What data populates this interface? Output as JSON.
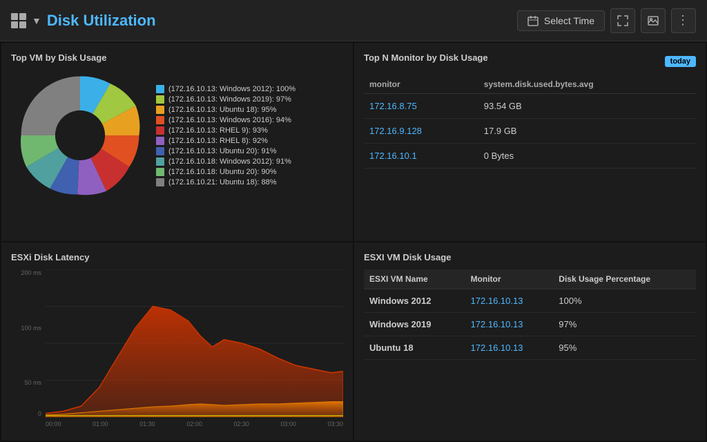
{
  "header": {
    "title": "Disk Utilization",
    "select_time_label": "Select Time"
  },
  "top_vm_panel": {
    "title": "Top VM by Disk Usage",
    "legend": [
      {
        "color": "#3bb0e8",
        "label": "(172.16.10.13: Windows 2012): 100%"
      },
      {
        "color": "#a0c840",
        "label": "(172.16.10.13: Windows 2019): 97%"
      },
      {
        "color": "#e8a020",
        "label": "(172.16.10.13: Ubuntu 18): 95%"
      },
      {
        "color": "#e05020",
        "label": "(172.16.10.13: Windows 2016): 94%"
      },
      {
        "color": "#c83030",
        "label": "(172.16.10.13: RHEL 9): 93%"
      },
      {
        "color": "#9060c0",
        "label": "(172.16.10.13: RHEL 8): 92%"
      },
      {
        "color": "#4060b0",
        "label": "(172.16.10.13: Ubuntu 20): 91%"
      },
      {
        "color": "#50a0a0",
        "label": "(172.16.10.18: Windows 2012): 91%"
      },
      {
        "color": "#70b870",
        "label": "(172.16.10.18: Ubuntu 20): 90%"
      },
      {
        "color": "#808080",
        "label": "(172.16.10.21: Ubuntu 18): 88%"
      }
    ],
    "pie_slices": [
      {
        "color": "#3bb0e8",
        "pct": 100
      },
      {
        "color": "#a0c840",
        "pct": 97
      },
      {
        "color": "#e8a020",
        "pct": 95
      },
      {
        "color": "#e05020",
        "pct": 94
      },
      {
        "color": "#c83030",
        "pct": 93
      },
      {
        "color": "#9060c0",
        "pct": 92
      },
      {
        "color": "#4060b0",
        "pct": 91
      },
      {
        "color": "#50a0a0",
        "pct": 91
      },
      {
        "color": "#70b870",
        "pct": 90
      },
      {
        "color": "#808080",
        "pct": 88
      }
    ]
  },
  "top_n_monitor_panel": {
    "title": "Top N Monitor by Disk Usage",
    "today_badge": "today",
    "columns": [
      "monitor",
      "system.disk.used.bytes.avg"
    ],
    "rows": [
      {
        "monitor": "172.16.8.75",
        "value": "93.54 GB"
      },
      {
        "monitor": "172.16.9.128",
        "value": "17.9 GB"
      },
      {
        "monitor": "172.16.10.1",
        "value": "0 Bytes"
      }
    ]
  },
  "esxi_latency_panel": {
    "title": "ESXi Disk Latency",
    "y_labels": [
      "200 ms",
      "",
      "100 ms",
      "",
      "50 ms",
      "0"
    ],
    "x_labels": [
      "00:00",
      "01:00",
      "01:30",
      "02:00",
      "02:30",
      "03:00",
      "03:30"
    ]
  },
  "esxi_vm_panel": {
    "title": "ESXI VM Disk Usage",
    "columns": [
      "ESXI VM Name",
      "Monitor",
      "Disk Usage Percentage"
    ],
    "rows": [
      {
        "name": "Windows  2012",
        "monitor": "172.16.10.13",
        "pct": "100%"
      },
      {
        "name": "Windows  2019",
        "monitor": "172.16.10.13",
        "pct": "97%"
      },
      {
        "name": "Ubuntu  18",
        "monitor": "172.16.10.13",
        "pct": "95%"
      }
    ]
  }
}
